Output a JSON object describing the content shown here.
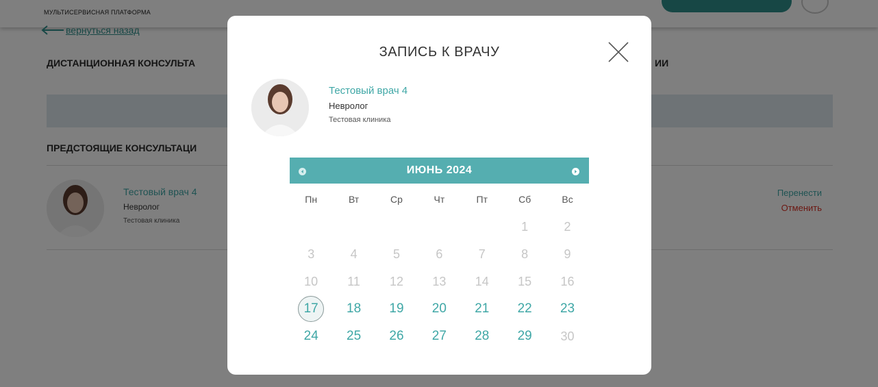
{
  "header": {
    "brand": "МУЛЬТИСЕРВИСНАЯ ПЛАТФОРМА"
  },
  "back_link": "вернуться назад",
  "background": {
    "section_remote": "ДИСТАНЦИОННАЯ КОНСУЛЬТА",
    "section_remote_tail": "ИИ",
    "section_upcoming": "ПРЕДСТОЯЩИЕ КОНСУЛЬТАЦИ",
    "card": {
      "doctor_name": "Тестовый врач 4",
      "specialty": "Невролог",
      "clinic": "Тестовая клиника",
      "reschedule": "Перенести",
      "cancel": "Отменить"
    }
  },
  "modal": {
    "title": "ЗАПИСЬ К ВРАЧУ",
    "doctor": {
      "name": "Тестовый врач 4",
      "specialty": "Невролог",
      "clinic": "Тестовая клиника"
    },
    "calendar": {
      "month_label": "ИЮНЬ 2024",
      "weekdays": [
        "Пн",
        "Вт",
        "Ср",
        "Чт",
        "Пт",
        "Сб",
        "Вс"
      ],
      "weeks": [
        [
          {
            "d": "",
            "s": "empty"
          },
          {
            "d": "",
            "s": "empty"
          },
          {
            "d": "",
            "s": "empty"
          },
          {
            "d": "",
            "s": "empty"
          },
          {
            "d": "",
            "s": "empty"
          },
          {
            "d": "1",
            "s": "past"
          },
          {
            "d": "2",
            "s": "past"
          }
        ],
        [
          {
            "d": "3",
            "s": "past"
          },
          {
            "d": "4",
            "s": "past"
          },
          {
            "d": "5",
            "s": "past"
          },
          {
            "d": "6",
            "s": "past"
          },
          {
            "d": "7",
            "s": "past"
          },
          {
            "d": "8",
            "s": "past"
          },
          {
            "d": "9",
            "s": "past"
          }
        ],
        [
          {
            "d": "10",
            "s": "past"
          },
          {
            "d": "11",
            "s": "past"
          },
          {
            "d": "12",
            "s": "past"
          },
          {
            "d": "13",
            "s": "past"
          },
          {
            "d": "14",
            "s": "past"
          },
          {
            "d": "15",
            "s": "past"
          },
          {
            "d": "16",
            "s": "past"
          }
        ],
        [
          {
            "d": "17",
            "s": "today"
          },
          {
            "d": "18",
            "s": "available"
          },
          {
            "d": "19",
            "s": "available"
          },
          {
            "d": "20",
            "s": "available"
          },
          {
            "d": "21",
            "s": "available"
          },
          {
            "d": "22",
            "s": "available"
          },
          {
            "d": "23",
            "s": "available"
          }
        ],
        [
          {
            "d": "24",
            "s": "available"
          },
          {
            "d": "25",
            "s": "available"
          },
          {
            "d": "26",
            "s": "available"
          },
          {
            "d": "27",
            "s": "available"
          },
          {
            "d": "28",
            "s": "available"
          },
          {
            "d": "29",
            "s": "available"
          },
          {
            "d": "30",
            "s": "past"
          }
        ]
      ]
    }
  },
  "colors": {
    "accent": "#3fa7a6",
    "calendar_header": "#55aeb0",
    "cancel": "#d93025",
    "overlay": "rgba(0,0,0,0.5)"
  }
}
